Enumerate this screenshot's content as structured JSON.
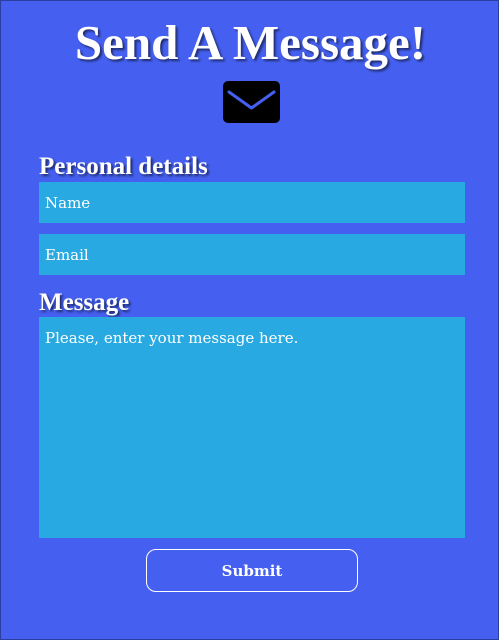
{
  "header": {
    "title": "Send A Message!",
    "icon": "envelope-icon"
  },
  "form": {
    "personal_label": "Personal details",
    "name_placeholder": "Name",
    "email_placeholder": "Email",
    "message_label": "Message",
    "message_placeholder": "Please, enter your message here.",
    "submit_label": "Submit"
  },
  "colors": {
    "background": "#4560f0",
    "field_background": "#29a9e1",
    "text": "#ffffff",
    "icon": "#000000"
  }
}
